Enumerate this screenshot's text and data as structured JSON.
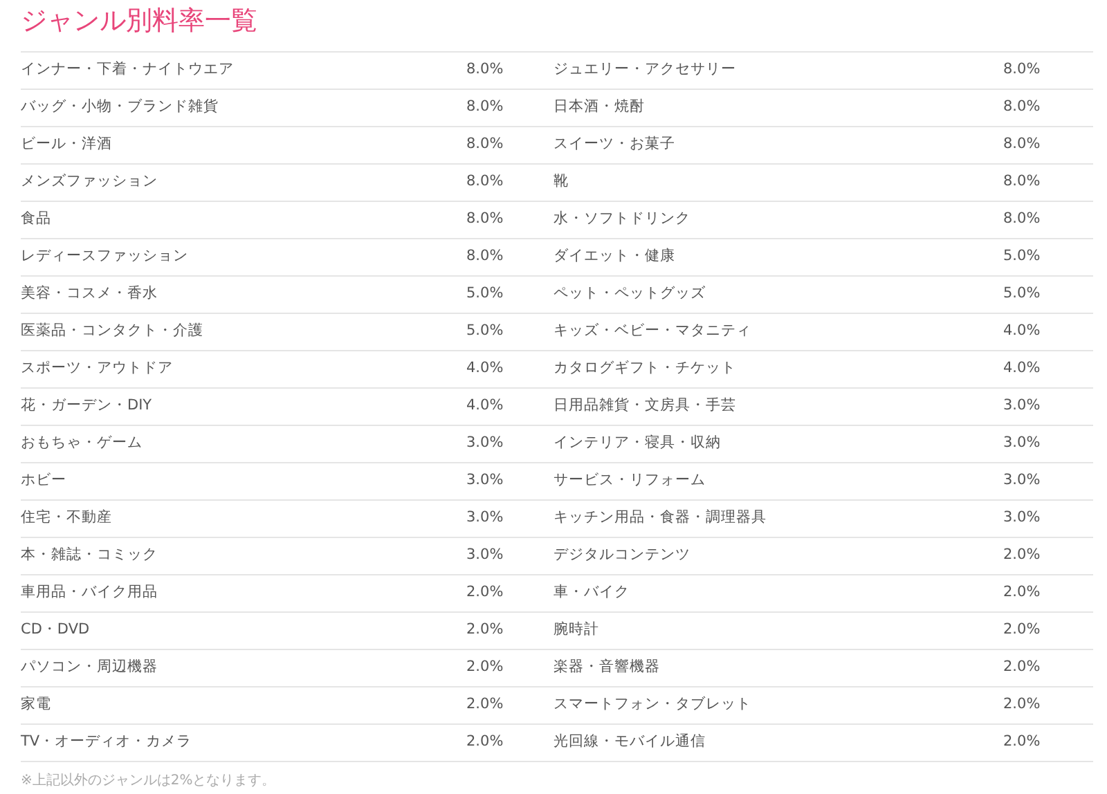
{
  "title": "ジャンル別料率一覧",
  "rows": [
    {
      "genre_1": "インナー・下着・ナイトウエア",
      "rate_1": "8.0%",
      "genre_2": "ジュエリー・アクセサリー",
      "rate_2": "8.0%"
    },
    {
      "genre_1": "バッグ・小物・ブランド雑貨",
      "rate_1": "8.0%",
      "genre_2": "日本酒・焼酎",
      "rate_2": "8.0%"
    },
    {
      "genre_1": "ビール・洋酒",
      "rate_1": "8.0%",
      "genre_2": "スイーツ・お菓子",
      "rate_2": "8.0%"
    },
    {
      "genre_1": "メンズファッション",
      "rate_1": "8.0%",
      "genre_2": "靴",
      "rate_2": "8.0%"
    },
    {
      "genre_1": "食品",
      "rate_1": "8.0%",
      "genre_2": "水・ソフトドリンク",
      "rate_2": "8.0%"
    },
    {
      "genre_1": "レディースファッション",
      "rate_1": "8.0%",
      "genre_2": "ダイエット・健康",
      "rate_2": "5.0%"
    },
    {
      "genre_1": "美容・コスメ・香水",
      "rate_1": "5.0%",
      "genre_2": "ペット・ペットグッズ",
      "rate_2": "5.0%"
    },
    {
      "genre_1": "医薬品・コンタクト・介護",
      "rate_1": "5.0%",
      "genre_2": "キッズ・ベビー・マタニティ",
      "rate_2": "4.0%"
    },
    {
      "genre_1": "スポーツ・アウトドア",
      "rate_1": "4.0%",
      "genre_2": "カタログギフト・チケット",
      "rate_2": "4.0%"
    },
    {
      "genre_1": "花・ガーデン・DIY",
      "rate_1": "4.0%",
      "genre_2": "日用品雑貨・文房具・手芸",
      "rate_2": "3.0%"
    },
    {
      "genre_1": "おもちゃ・ゲーム",
      "rate_1": "3.0%",
      "genre_2": "インテリア・寝具・収納",
      "rate_2": "3.0%"
    },
    {
      "genre_1": "ホビー",
      "rate_1": "3.0%",
      "genre_2": "サービス・リフォーム",
      "rate_2": "3.0%"
    },
    {
      "genre_1": "住宅・不動産",
      "rate_1": "3.0%",
      "genre_2": "キッチン用品・食器・調理器具",
      "rate_2": "3.0%"
    },
    {
      "genre_1": "本・雑誌・コミック",
      "rate_1": "3.0%",
      "genre_2": "デジタルコンテンツ",
      "rate_2": "2.0%"
    },
    {
      "genre_1": "車用品・バイク用品",
      "rate_1": "2.0%",
      "genre_2": "車・バイク",
      "rate_2": "2.0%"
    },
    {
      "genre_1": "CD・DVD",
      "rate_1": "2.0%",
      "genre_2": "腕時計",
      "rate_2": "2.0%"
    },
    {
      "genre_1": "パソコン・周辺機器",
      "rate_1": "2.0%",
      "genre_2": "楽器・音響機器",
      "rate_2": "2.0%"
    },
    {
      "genre_1": "家電",
      "rate_1": "2.0%",
      "genre_2": "スマートフォン・タブレット",
      "rate_2": "2.0%"
    },
    {
      "genre_1": "TV・オーディオ・カメラ",
      "rate_1": "2.0%",
      "genre_2": "光回線・モバイル通信",
      "rate_2": "2.0%"
    }
  ],
  "note": "※上記以外のジャンルは2%となります。"
}
